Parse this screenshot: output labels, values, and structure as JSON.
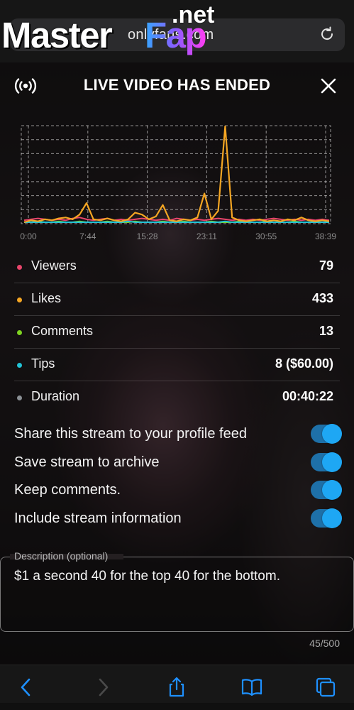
{
  "browser": {
    "url": "onlyfans.com",
    "reload_icon": "reload-icon"
  },
  "watermark": {
    "master": "Master",
    "fap": "Fap",
    "net": ".net"
  },
  "panel": {
    "title": "LIVE VIDEO HAS ENDED",
    "live_icon": "broadcast-icon",
    "close_icon": "close-icon"
  },
  "chart_data": {
    "type": "line",
    "x_ticks": [
      "0:00",
      "7:44",
      "15:28",
      "23:11",
      "30:55",
      "38:39"
    ],
    "grid": true,
    "series": [
      {
        "color": "#f5a623",
        "values": [
          0,
          0.02,
          0.01,
          0.03,
          0.02,
          0.04,
          0.05,
          0.03,
          0.08,
          0.2,
          0.03,
          0.02,
          0.04,
          0.02,
          0.01,
          0.03,
          0.1,
          0.08,
          0.03,
          0.06,
          0.18,
          0.02,
          0.01,
          0.03,
          0.02,
          0.05,
          0.3,
          0.03,
          0.12,
          1.0,
          0.05,
          0.02,
          0.01,
          0.02,
          0.03,
          0.01,
          0.02,
          0.01,
          0.03,
          0.02,
          0.05,
          0.02,
          0.01,
          0.02,
          0.01
        ]
      },
      {
        "color": "#e8456b",
        "values": [
          0.02,
          0.03,
          0.04,
          0.03,
          0.02,
          0.03,
          0.02,
          0.04,
          0.05,
          0.03,
          0.02,
          0.03,
          0.04,
          0.02,
          0.03,
          0.02,
          0.03,
          0.04,
          0.03,
          0.02,
          0.03,
          0.02,
          0.04,
          0.03,
          0.02,
          0.03,
          0.02,
          0.03,
          0.04,
          0.03,
          0.02,
          0.03,
          0.02,
          0.03,
          0.02,
          0.03,
          0.04,
          0.03,
          0.02,
          0.03,
          0.02,
          0.03,
          0.02,
          0.03,
          0.02
        ]
      },
      {
        "color": "#7ed321",
        "values": [
          0,
          0,
          0.01,
          0,
          0,
          0.01,
          0,
          0,
          0.01,
          0,
          0,
          0,
          0.01,
          0,
          0,
          0,
          0.01,
          0,
          0,
          0,
          0.01,
          0,
          0,
          0.01,
          0,
          0,
          0,
          0.01,
          0,
          0,
          0,
          0.01,
          0,
          0,
          0,
          0.01,
          0,
          0,
          0,
          0.01,
          0,
          0,
          0,
          0,
          0
        ]
      },
      {
        "color": "#22c3d6",
        "values": [
          0,
          0,
          0,
          0,
          0,
          0,
          0,
          0,
          0,
          0,
          0,
          0,
          0,
          0,
          0,
          0.01,
          0,
          0,
          0,
          0,
          0,
          0,
          0,
          0,
          0,
          0,
          0,
          0,
          0,
          0.01,
          0,
          0,
          0,
          0,
          0,
          0,
          0,
          0,
          0,
          0,
          0,
          0,
          0,
          0,
          0
        ]
      }
    ]
  },
  "stats": [
    {
      "label": "Viewers",
      "value": "79",
      "color": "#e8456b"
    },
    {
      "label": "Likes",
      "value": "433",
      "color": "#f5a623"
    },
    {
      "label": "Comments",
      "value": "13",
      "color": "#7ed321"
    },
    {
      "label": "Tips",
      "value": "8 ($60.00)",
      "color": "#22c3d6"
    },
    {
      "label": "Duration",
      "value": "00:40:22",
      "color": "#8a8f94"
    }
  ],
  "options": [
    {
      "label": "Share this stream to your profile feed",
      "on": true
    },
    {
      "label": "Save stream to archive",
      "on": true
    },
    {
      "label": "Keep comments.",
      "on": true
    },
    {
      "label": "Include stream information",
      "on": true
    }
  ],
  "description": {
    "label": "Description (optional)",
    "value": "$1 a second 40 for the top 40 for the bottom.",
    "count": "45/500"
  },
  "toolbar": {
    "icons": [
      "back-icon",
      "forward-icon",
      "share-icon",
      "bookmarks-icon",
      "tabs-icon"
    ]
  }
}
